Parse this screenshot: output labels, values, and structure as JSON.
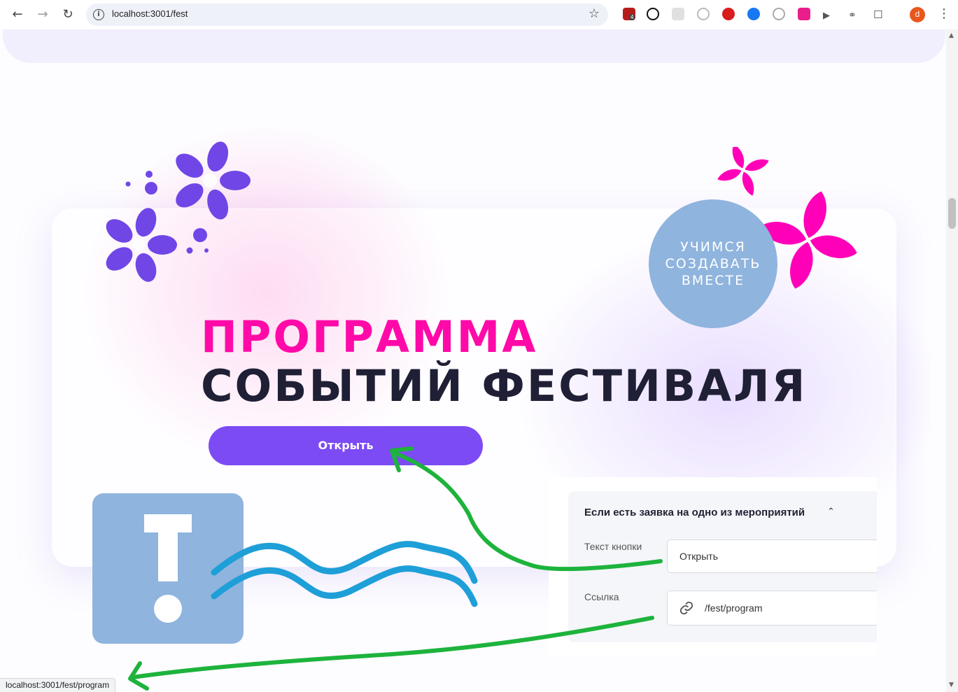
{
  "browser": {
    "url": "localhost:3001/fest",
    "extension_badge": "4",
    "profile_initial": "d",
    "extension_colors": [
      "#b71c1c",
      "#111111",
      "#d8d8d8",
      "#cfcfcf",
      "#d91c1c",
      "#1877f2",
      "#9e9e9e",
      "#e91e8c",
      "#555555",
      "#666666"
    ]
  },
  "hero": {
    "title_line1": "ПРОГРАММА",
    "title_line2": "СОБЫТИЙ ФЕСТИВАЛЯ",
    "button_label": "Открыть",
    "circle_lines": [
      "УЧИМСЯ",
      "СОЗДАВАТЬ",
      "ВМЕСТЕ"
    ]
  },
  "settings": {
    "heading": "Если есть заявка на одно из мероприятий",
    "button_text_label": "Текст кнопки",
    "button_text_value": "Открыть",
    "link_label": "Ссылка",
    "link_value": "/fest/program"
  },
  "status_bar": {
    "text": "localhost:3001/fest/program"
  },
  "colors": {
    "accent_pink": "#ff0aa8",
    "accent_purple": "#7c4bf3",
    "flower_purple": "#7046e6",
    "flower_magenta": "#ff00b8",
    "tile_blue": "#8fb4de",
    "wave_blue": "#1e9fd8",
    "annotation_green": "#1db33c"
  }
}
